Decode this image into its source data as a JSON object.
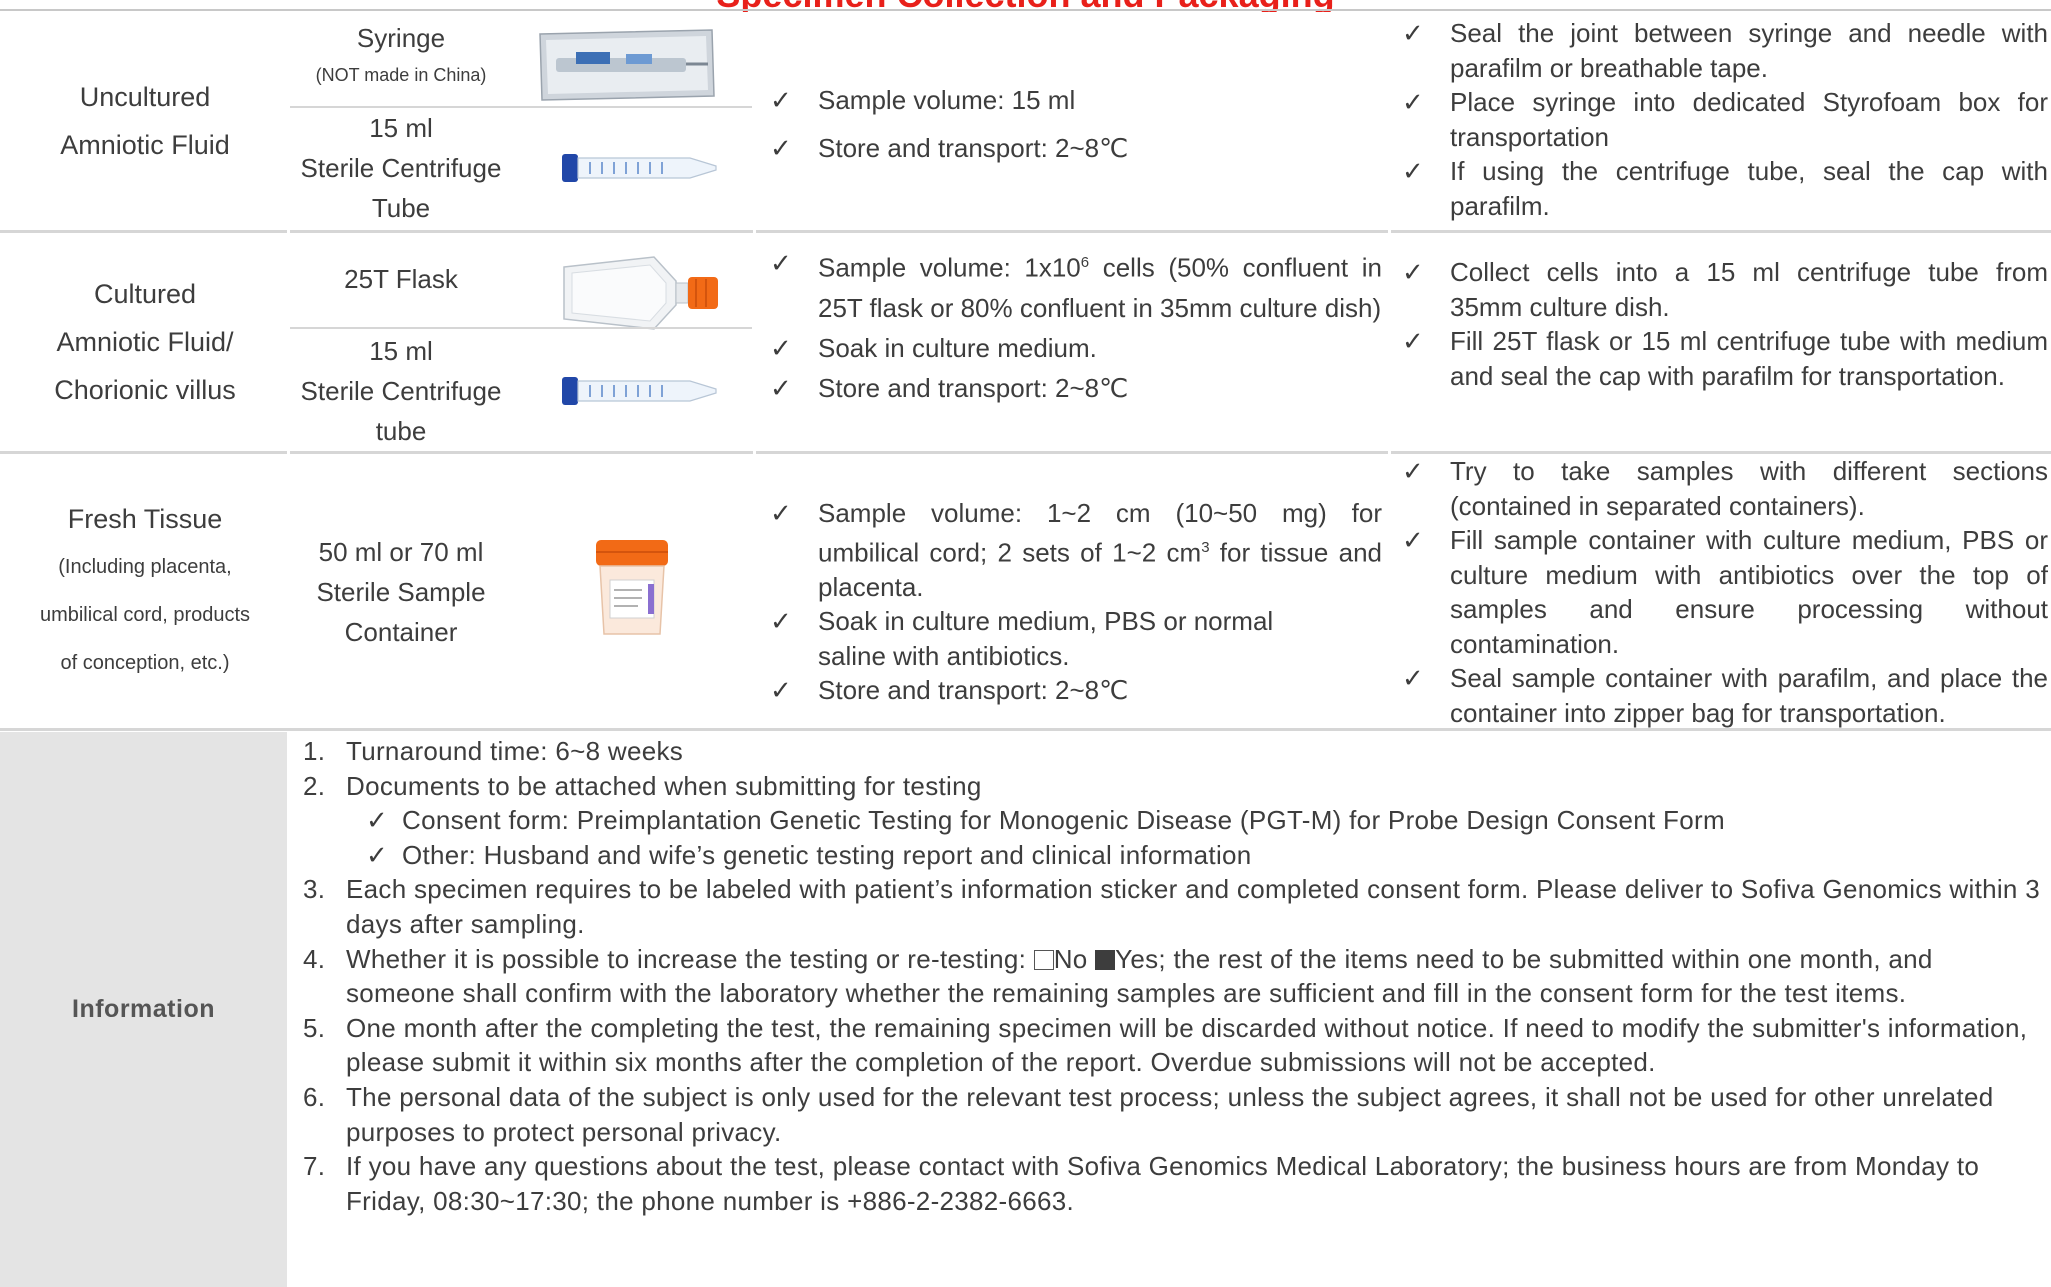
{
  "page_title": "Specimen Collection and Packaging",
  "colors": {
    "title": "#e8201a",
    "info_label_bg": "#e4e4e4",
    "separator": "#d6d6d6"
  },
  "specimens": [
    {
      "type_lines": [
        "Uncultured",
        "Amniotic Fluid"
      ],
      "containers": [
        {
          "name_lines": [
            "Syringe"
          ],
          "note": "(NOT made in China)",
          "icon": "syringe-package-icon"
        },
        {
          "name_lines": [
            "15 ml",
            "Sterile Centrifuge",
            "Tube"
          ],
          "icon": "centrifuge-tube-icon"
        }
      ],
      "requirements": [
        "Sample volume: 15 ml",
        "Store and transport: 2~8℃"
      ],
      "packaging": [
        "Seal the joint between syringe and needle with parafilm or breathable tape.",
        "Place syringe into dedicated Styrofoam box for transportation",
        "If using the centrifuge tube, seal the cap with parafilm."
      ]
    },
    {
      "type_lines": [
        "Cultured",
        "Amniotic Fluid/",
        "Chorionic villus"
      ],
      "containers": [
        {
          "name_lines": [
            "25T Flask"
          ],
          "icon": "culture-flask-icon"
        },
        {
          "name_lines": [
            "15 ml",
            "Sterile Centrifuge",
            "tube"
          ],
          "icon": "centrifuge-tube-icon"
        }
      ],
      "requirements": {
        "volume_prefix": "Sample volume: 1x10",
        "volume_exponent": "6",
        "volume_suffix": " cells (50% confluent in 25T flask or 80% confluent in 35mm culture dish)",
        "soak": "Soak in culture medium.",
        "store": "Store and transport: 2~8℃"
      },
      "packaging": [
        "Collect cells into a 15 ml centrifuge tube from 35mm culture dish.",
        "Fill 25T flask or 15 ml centrifuge tube with medium and seal the cap with parafilm for transportation."
      ]
    },
    {
      "type_lines": [
        "Fresh Tissue"
      ],
      "type_small_lines": [
        "(Including placenta,",
        "umbilical cord, products",
        "of conception, etc.)"
      ],
      "containers": [
        {
          "name_lines": [
            "50 ml or 70 ml",
            "Sterile Sample",
            "Container"
          ],
          "icon": "sample-container-icon"
        }
      ],
      "requirements": {
        "volume_prefix": "Sample volume: 1~2 cm (10~50 mg) for umbilical cord; 2 sets of 1~2 cm",
        "volume_exponent": "3",
        "volume_suffix": " for tissue and placenta.",
        "soak": "Soak in culture medium, PBS or normal saline with antibiotics.",
        "store": "Store and transport: 2~8℃"
      },
      "packaging": [
        "Try to take samples with different sections (contained in separated containers).",
        "Fill sample container with culture medium, PBS or culture medium with antibiotics over the top of samples and ensure processing without contamination.",
        "Seal sample container with parafilm, and place the container into zipper bag for transportation."
      ]
    }
  ],
  "information": {
    "label": "Information",
    "items": {
      "1": "Turnaround time: 6~8 weeks",
      "2": "Documents to be attached when submitting for testing",
      "2a": "Consent form: Preimplantation Genetic Testing for Monogenic Disease (PGT-M) for Probe Design Consent Form",
      "2b": "Other: Husband and wife’s genetic testing report and clinical information",
      "3": "Each specimen requires to be labeled with patient’s information sticker and completed consent form. Please deliver to Sofiva Genomics within 3 days after sampling.",
      "4_prefix": "Whether it is possible to increase the testing or re-testing: ",
      "4_no": "No",
      "4_yes": "Yes",
      "4_suffix": "; the rest of the items need to be submitted within one month, and someone shall confirm with the laboratory whether the remaining samples are sufficient and fill in the consent form for the test items.",
      "4_checked": "Yes",
      "5": "One month after the completing the test, the remaining specimen will be discarded without notice. If need to modify the submitter's information, please submit it within six months after the completion of the report. Overdue submissions will not be accepted.",
      "6": "The personal data of the subject is only used for the relevant test process; unless the subject agrees, it shall not be used for other unrelated purposes to protect personal privacy.",
      "7": "If you have any questions about the test, please contact with Sofiva Genomics Medical Laboratory; the business hours are from Monday to Friday, 08:30~17:30; the phone number is +886-2-2382-6663."
    },
    "numbers": [
      "1.",
      "2.",
      "3.",
      "4.",
      "5.",
      "6.",
      "7."
    ]
  }
}
